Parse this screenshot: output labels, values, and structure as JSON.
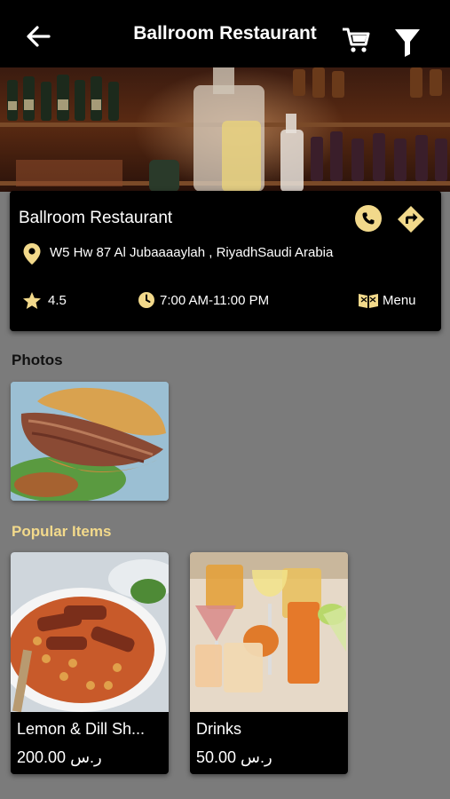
{
  "header": {
    "title": "Ballroom Restaurant",
    "back_icon": "back-arrow-icon",
    "cart_icon": "cart-icon",
    "filter_icon": "filter-icon"
  },
  "restaurant": {
    "name": "Ballroom Restaurant",
    "address": "W5 Hw 87 Al Jubaaaaylah , RiyadhSaudi Arabia",
    "rating": "4.5",
    "hours": "7:00 AM-11:00 PM",
    "menu_label": "Menu"
  },
  "sections": {
    "photos_title": "Photos",
    "popular_title": "Popular Items"
  },
  "popular_items": [
    {
      "name": "Lemon & Dill Sh...",
      "price": "200.00 ر.س"
    },
    {
      "name": "Drinks",
      "price": "50.00 ر.س"
    }
  ],
  "colors": {
    "accent": "#f2d98b",
    "background": "#7b7b7b",
    "card": "#000000"
  }
}
